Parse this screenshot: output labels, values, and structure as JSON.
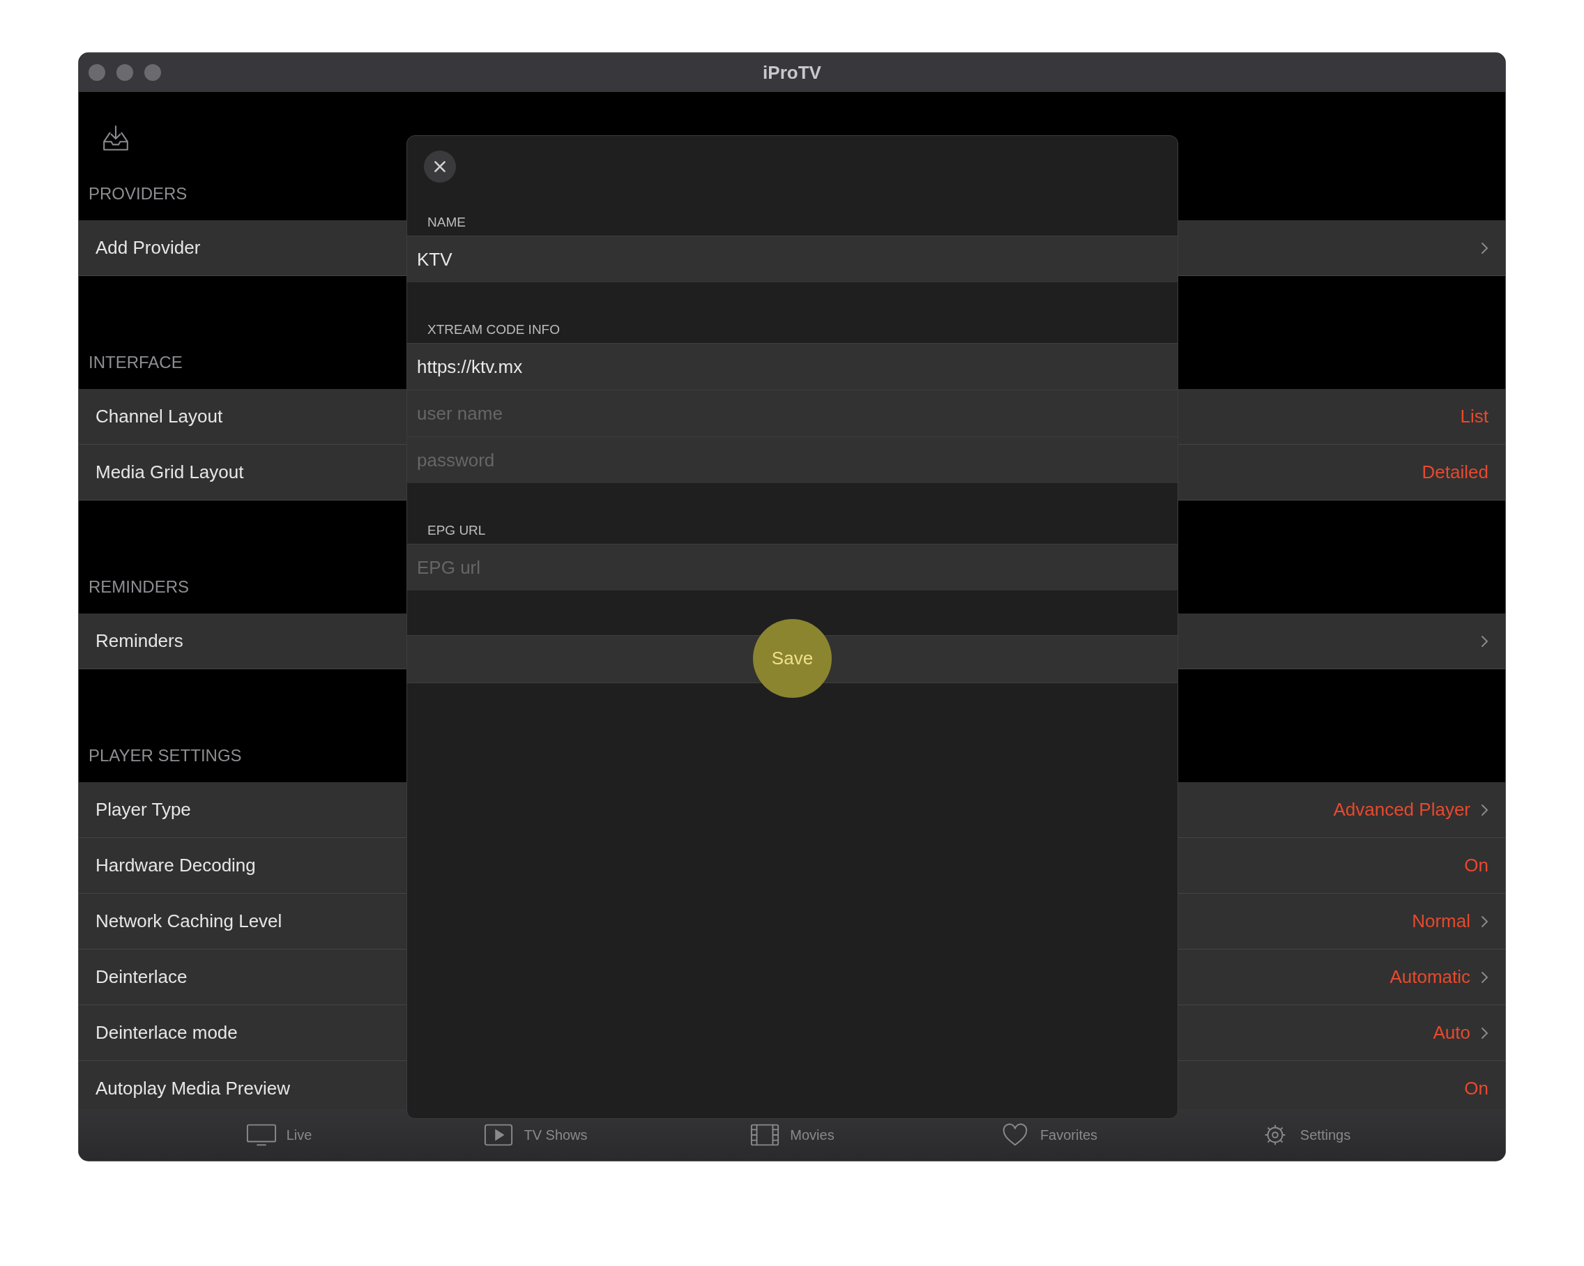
{
  "window": {
    "title": "iProTV"
  },
  "sections": [
    {
      "header": "PROVIDERS",
      "rows": [
        {
          "label": "Add Provider",
          "value": null,
          "chevron": true
        }
      ]
    },
    {
      "header": "INTERFACE",
      "rows": [
        {
          "label": "Channel Layout",
          "value": "List",
          "chevron": false
        },
        {
          "label": "Media Grid Layout",
          "value": "Detailed",
          "chevron": false
        }
      ]
    },
    {
      "header": "REMINDERS",
      "rows": [
        {
          "label": "Reminders",
          "value": null,
          "chevron": true
        }
      ]
    },
    {
      "header": "PLAYER SETTINGS",
      "rows": [
        {
          "label": "Player Type",
          "value": "Advanced Player",
          "chevron": true
        },
        {
          "label": "Hardware Decoding",
          "value": "On",
          "chevron": false
        },
        {
          "label": "Network Caching Level",
          "value": "Normal",
          "chevron": true
        },
        {
          "label": "Deinterlace",
          "value": "Automatic",
          "chevron": true
        },
        {
          "label": "Deinterlace mode",
          "value": "Auto",
          "chevron": true
        },
        {
          "label": "Autoplay Media Preview",
          "value": "On",
          "chevron": false
        }
      ]
    }
  ],
  "modal": {
    "groups": [
      {
        "label": "NAME",
        "fields": [
          {
            "value": "KTV"
          }
        ]
      },
      {
        "label": "XTREAM CODE INFO",
        "fields": [
          {
            "value": "https://ktv.mx"
          },
          {
            "placeholder": "user name"
          },
          {
            "placeholder": "password"
          }
        ]
      },
      {
        "label": "EPG URL",
        "fields": [
          {
            "placeholder": "EPG url"
          }
        ]
      }
    ],
    "save": "Save"
  },
  "tab_bar": [
    {
      "label": "Live",
      "selected": false
    },
    {
      "label": "TV Shows",
      "selected": false
    },
    {
      "label": "Movies",
      "selected": false
    },
    {
      "label": "Favorites",
      "selected": false
    },
    {
      "label": "Settings",
      "selected": false
    }
  ]
}
